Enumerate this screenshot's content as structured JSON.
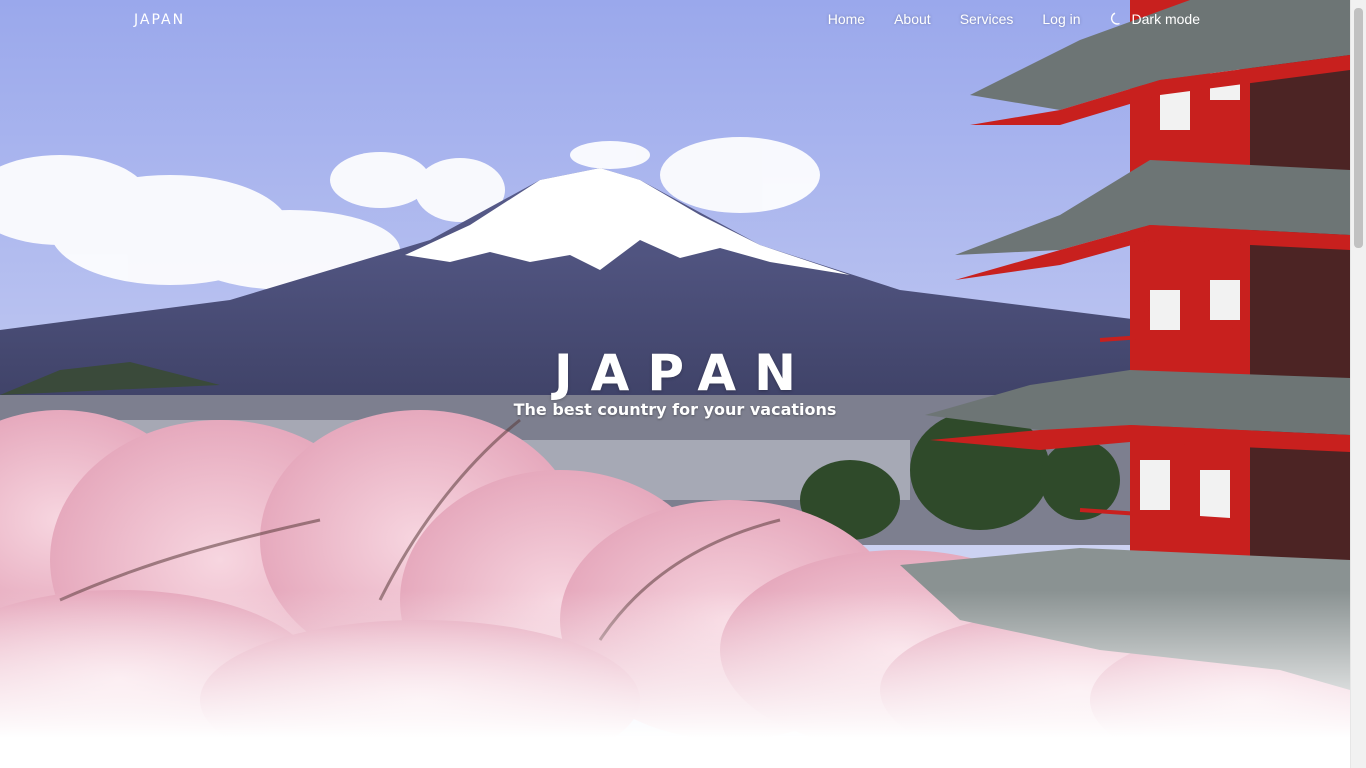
{
  "nav": {
    "brand": "JAPAN",
    "links": [
      "Home",
      "About",
      "Services",
      "Log in"
    ],
    "dark_mode_label": "Dark mode",
    "dark_mode_icon": "moon-icon"
  },
  "hero": {
    "title": "JAPAN",
    "subtitle": "The best country for your vacations"
  },
  "colors": {
    "sky_top": "#a8b4ee",
    "sky_bottom": "#d6dcf4",
    "mountain": "#4a4f7a",
    "snow": "#ffffff",
    "blossom": "#f2c6d3",
    "pagoda_red": "#c8201e",
    "roof": "#6d7575"
  }
}
